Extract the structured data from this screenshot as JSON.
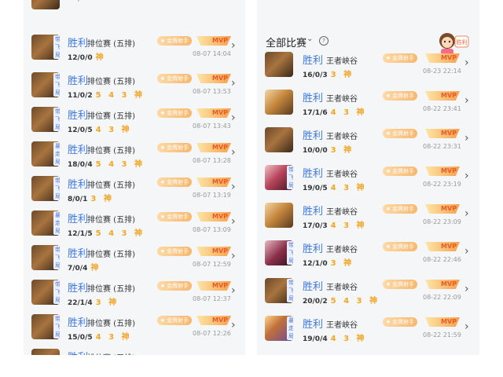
{
  "header": {
    "filter_title": "全部比赛",
    "filter_chevron": "⌄",
    "help_label": "?",
    "mascot_badge": "胜利"
  },
  "left_list": [
    {
      "result": "胜利",
      "mode": "排位赛 (五排)",
      "kda": "12/0/0",
      "gods": "神",
      "time": "08-07 14:04",
      "tag": "带飞局"
    },
    {
      "result": "胜利",
      "mode": "排位赛 (五排)",
      "kda": "11/0/2",
      "gods": "5 4 3 神",
      "time": "08-07 13:53",
      "tag": "带飞局"
    },
    {
      "result": "胜利",
      "mode": "排位赛 (五排)",
      "kda": "12/0/5",
      "gods": "4 3 神",
      "time": "08-07 13:43",
      "tag": "带飞局"
    },
    {
      "result": "胜利",
      "mode": "排位赛 (五排)",
      "kda": "18/0/4",
      "gods": "5 4 3 神",
      "time": "08-07 13:28",
      "tag": "暴走局"
    },
    {
      "result": "胜利",
      "mode": "排位赛 (五排)",
      "kda": "8/0/1",
      "gods": "3 神",
      "time": "08-07 13:19",
      "tag": "带飞局"
    },
    {
      "result": "胜利",
      "mode": "排位赛 (五排)",
      "kda": "12/1/5",
      "gods": "5 4 3 神",
      "time": "08-07 13:09",
      "tag": "暴走局"
    },
    {
      "result": "胜利",
      "mode": "排位赛 (五排)",
      "kda": "7/0/4",
      "gods": "神",
      "time": "08-07 12:59",
      "tag": "带飞局"
    },
    {
      "result": "胜利",
      "mode": "排位赛 (五排)",
      "kda": "22/1/4",
      "gods": "3 神",
      "time": "08-07 12:37",
      "tag": "带飞局"
    },
    {
      "result": "胜利",
      "mode": "排位赛 (五排)",
      "kda": "15/0/5",
      "gods": "4 3 神",
      "time": "08-07 12:26",
      "tag": "带飞局"
    }
  ],
  "right_list": [
    {
      "result": "胜利",
      "mode": "王者峡谷",
      "kda": "16/0/3",
      "gods": "3 神",
      "time": "08-23 22:14"
    },
    {
      "result": "胜利",
      "mode": "王者峡谷",
      "kda": "17/1/6",
      "gods": "4 3 神",
      "time": "08-22 23:41"
    },
    {
      "result": "胜利",
      "mode": "王者峡谷",
      "kda": "10/0/0",
      "gods": "3 神",
      "time": "08-22 23:31"
    },
    {
      "result": "胜利",
      "mode": "王者峡谷",
      "kda": "19/0/5",
      "gods": "4 3 神",
      "time": "08-22 23:19",
      "tag": "带飞局"
    },
    {
      "result": "胜利",
      "mode": "王者峡谷",
      "kda": "17/0/3",
      "gods": "4 3 神",
      "time": "08-22 23:09"
    },
    {
      "result": "胜利",
      "mode": "王者峡谷",
      "kda": "12/1/0",
      "gods": "3 神",
      "time": "08-22 22:46",
      "tag": "带飞局"
    },
    {
      "result": "胜利",
      "mode": "王者峡谷",
      "kda": "20/0/2",
      "gods": "5 4 3 神",
      "time": "08-22 22:09",
      "tag": "带飞局"
    },
    {
      "result": "胜利",
      "mode": "王者峡谷",
      "kda": "19/0/4",
      "gods": "4 3 神",
      "time": "08-22 21:59",
      "tag": "暴走局"
    }
  ],
  "badges": {
    "gold": "金牌射手",
    "mvp": "MVP"
  },
  "icons": {
    "chevron": "›",
    "star": "★"
  },
  "colors": {
    "result_blue": "#3f78e0",
    "god_orange": "#f3a626",
    "time_gray": "#999999"
  }
}
